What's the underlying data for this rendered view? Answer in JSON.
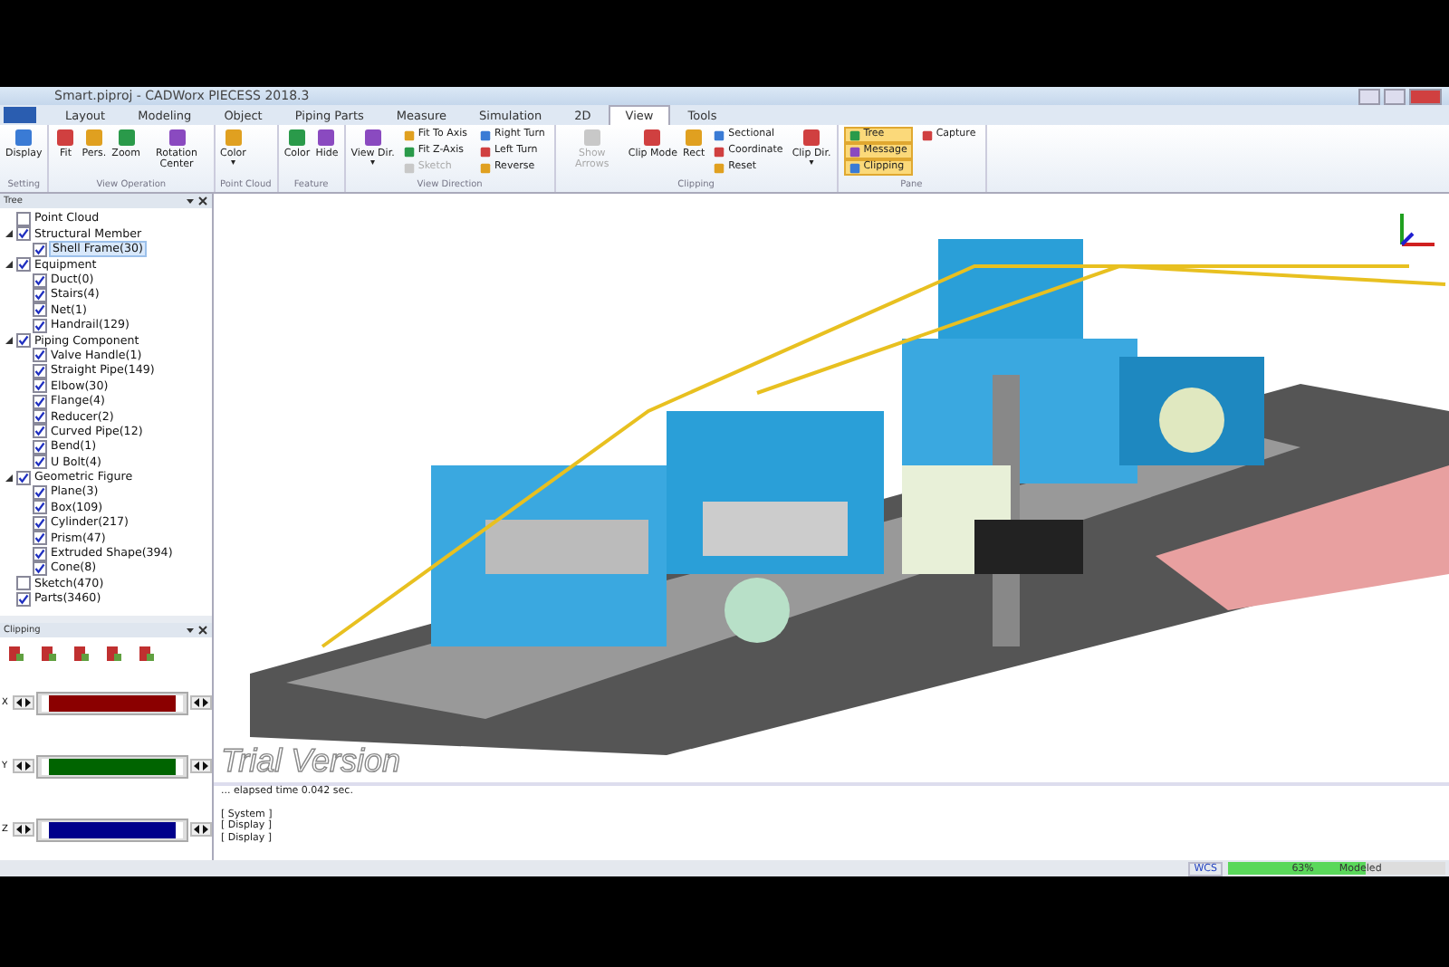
{
  "window": {
    "title": "Smart.piproj - CADWorx PIECESS 2018.3"
  },
  "tabs": [
    {
      "label": "Layout",
      "selected": false
    },
    {
      "label": "Modeling",
      "selected": false
    },
    {
      "label": "Object",
      "selected": false
    },
    {
      "label": "Piping Parts",
      "selected": false
    },
    {
      "label": "Measure",
      "selected": false
    },
    {
      "label": "Simulation",
      "selected": false
    },
    {
      "label": "2D",
      "selected": false
    },
    {
      "label": "View",
      "selected": true
    },
    {
      "label": "Tools",
      "selected": false
    }
  ],
  "ribbon": [
    {
      "label": "Setting",
      "items": [
        {
          "label": "Display",
          "kind": "large",
          "disabled": false
        }
      ]
    },
    {
      "label": "View Operation",
      "items": [
        {
          "label": "Fit",
          "kind": "large",
          "disabled": false
        },
        {
          "label": "Pers.",
          "kind": "large",
          "disabled": false
        },
        {
          "label": "Zoom",
          "kind": "large",
          "disabled": false
        },
        {
          "label": "Rotation Center",
          "kind": "large",
          "disabled": false
        }
      ]
    },
    {
      "label": "Point Cloud",
      "items": [
        {
          "label": "Color",
          "kind": "large",
          "disabled": false,
          "caret": "▾"
        }
      ]
    },
    {
      "label": "Feature",
      "items": [
        {
          "label": "Color",
          "kind": "large",
          "disabled": false
        },
        {
          "label": "Hide",
          "kind": "large",
          "disabled": false
        }
      ]
    },
    {
      "label": "View Direction",
      "items": [
        {
          "label": "View Dir.",
          "kind": "large",
          "disabled": false,
          "caret": "▾"
        },
        {
          "label": "Fit To Axis",
          "kind": "small",
          "disabled": false
        },
        {
          "label": "Fit Z-Axis",
          "kind": "small",
          "disabled": false
        },
        {
          "label": "Sketch",
          "kind": "small",
          "disabled": true
        },
        {
          "label": "Right Turn",
          "kind": "small",
          "disabled": false
        },
        {
          "label": "Left Turn",
          "kind": "small",
          "disabled": false
        },
        {
          "label": "Reverse",
          "kind": "small",
          "disabled": false
        }
      ]
    },
    {
      "label": "Clipping",
      "items": [
        {
          "label": "Show Arrows",
          "kind": "large",
          "disabled": true
        },
        {
          "label": "Clip Mode",
          "kind": "large",
          "disabled": false
        },
        {
          "label": "Rect",
          "kind": "large",
          "disabled": false
        },
        {
          "label": "Sectional",
          "kind": "small",
          "disabled": false
        },
        {
          "label": "Coordinate",
          "kind": "small",
          "disabled": false
        },
        {
          "label": "Reset",
          "kind": "small",
          "disabled": false
        },
        {
          "label": "Clip Dir.",
          "kind": "large",
          "disabled": false,
          "caret": "▾"
        }
      ]
    },
    {
      "label": "Pane",
      "items": [
        {
          "label": "Tree",
          "kind": "small",
          "disabled": false,
          "selected": true
        },
        {
          "label": "Message",
          "kind": "small",
          "disabled": false,
          "selected": true
        },
        {
          "label": "Clipping",
          "kind": "small",
          "disabled": false,
          "selected": true
        },
        {
          "label": "Capture",
          "kind": "small",
          "disabled": false,
          "selected": false
        }
      ]
    }
  ],
  "tree": {
    "title": "Tree",
    "items": [
      {
        "label": "Point Cloud",
        "checked": false,
        "selected": false
      },
      {
        "label": "Structural Member",
        "checked": true,
        "selected": false,
        "expanded": true,
        "children": [
          {
            "label": "Shell Frame(30)",
            "checked": true,
            "selected": true
          }
        ]
      },
      {
        "label": "Equipment",
        "checked": true,
        "selected": false,
        "expanded": true,
        "children": [
          {
            "label": "Duct(0)",
            "checked": true,
            "selected": false
          },
          {
            "label": "Stairs(4)",
            "checked": true,
            "selected": false
          },
          {
            "label": "Net(1)",
            "checked": true,
            "selected": false
          },
          {
            "label": "Handrail(129)",
            "checked": true,
            "selected": false
          }
        ]
      },
      {
        "label": "Piping Component",
        "checked": true,
        "selected": false,
        "expanded": true,
        "children": [
          {
            "label": "Valve Handle(1)",
            "checked": true,
            "selected": false
          },
          {
            "label": "Straight Pipe(149)",
            "checked": true,
            "selected": false
          },
          {
            "label": "Elbow(30)",
            "checked": true,
            "selected": false
          },
          {
            "label": "Flange(4)",
            "checked": true,
            "selected": false
          },
          {
            "label": "Reducer(2)",
            "checked": true,
            "selected": false
          },
          {
            "label": "Curved Pipe(12)",
            "checked": true,
            "selected": false
          },
          {
            "label": "Bend(1)",
            "checked": true,
            "selected": false
          },
          {
            "label": "U Bolt(4)",
            "checked": true,
            "selected": false
          }
        ]
      },
      {
        "label": "Geometric Figure",
        "checked": true,
        "selected": false,
        "expanded": true,
        "children": [
          {
            "label": "Plane(3)",
            "checked": true,
            "selected": false
          },
          {
            "label": "Box(109)",
            "checked": true,
            "selected": false
          },
          {
            "label": "Cylinder(217)",
            "checked": true,
            "selected": false
          },
          {
            "label": "Prism(47)",
            "checked": true,
            "selected": false
          },
          {
            "label": "Extruded Shape(394)",
            "checked": true,
            "selected": false
          },
          {
            "label": "Cone(8)",
            "checked": true,
            "selected": false
          }
        ]
      },
      {
        "label": "Sketch(470)",
        "checked": false,
        "selected": false
      },
      {
        "label": "Parts(3460)",
        "checked": true,
        "selected": false
      }
    ]
  },
  "clipping": {
    "title": "Clipping",
    "axes": [
      {
        "label": "X",
        "color": "#8b0000"
      },
      {
        "label": "Y",
        "color": "#006400"
      },
      {
        "label": "Z",
        "color": "#00008b"
      }
    ]
  },
  "viewport": {
    "watermark": "Trial Version"
  },
  "messages": [
    "... elapsed time 0.042 sec.",
    "[ System ]",
    "[ Display ]",
    "[ Display ]"
  ],
  "status_bar": {
    "coordinate": "WCS",
    "progress": {
      "level": 0.63,
      "percent": "63%",
      "label": "Modeled"
    }
  }
}
